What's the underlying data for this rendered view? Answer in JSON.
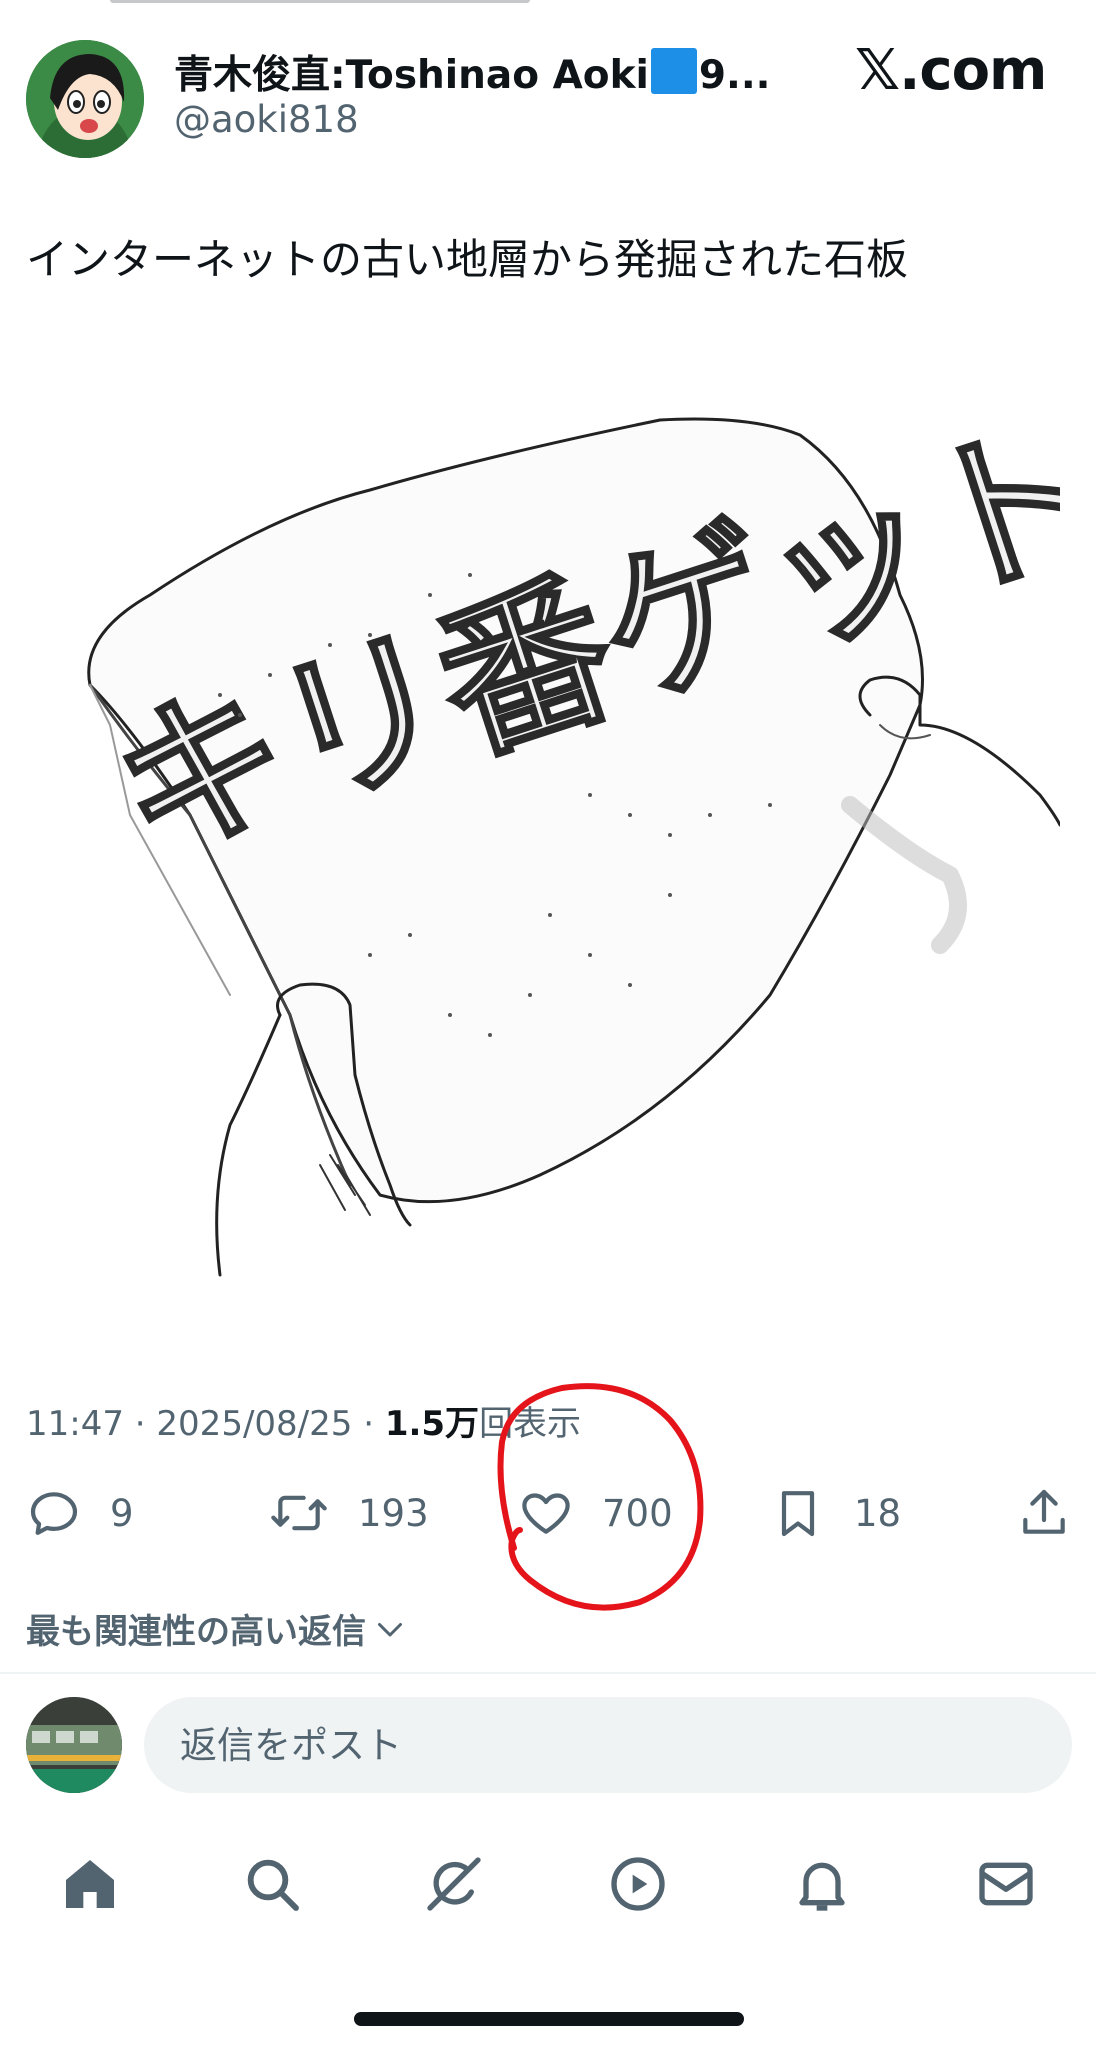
{
  "author": {
    "display_name_prefix": "青木俊直:Toshinao Aoki",
    "display_name_suffix": "9...",
    "handle": "@aoki818"
  },
  "brand": {
    "label": "𝕏.com"
  },
  "tweet": {
    "text": "インターネットの古い地層から発掘された石板",
    "image_text": "キリ番ゲット"
  },
  "meta": {
    "time": "11:47",
    "date": "2025/08/25",
    "views_count": "1.5万",
    "views_label": "回表示"
  },
  "actions": {
    "replies": "9",
    "reposts": "193",
    "likes": "700",
    "bookmarks": "18"
  },
  "sort": {
    "label": "最も関連性の高い返信"
  },
  "reply": {
    "placeholder": "返信をポスト"
  },
  "nav": [
    "home-icon",
    "search-icon",
    "grok-icon",
    "video-icon",
    "bell-icon",
    "mail-icon"
  ],
  "colors": {
    "accent": "#1d9bf0",
    "text": "#0f1419",
    "secondary": "#536471",
    "annotation": "#e4141a",
    "flag": "#1d8fe6"
  }
}
